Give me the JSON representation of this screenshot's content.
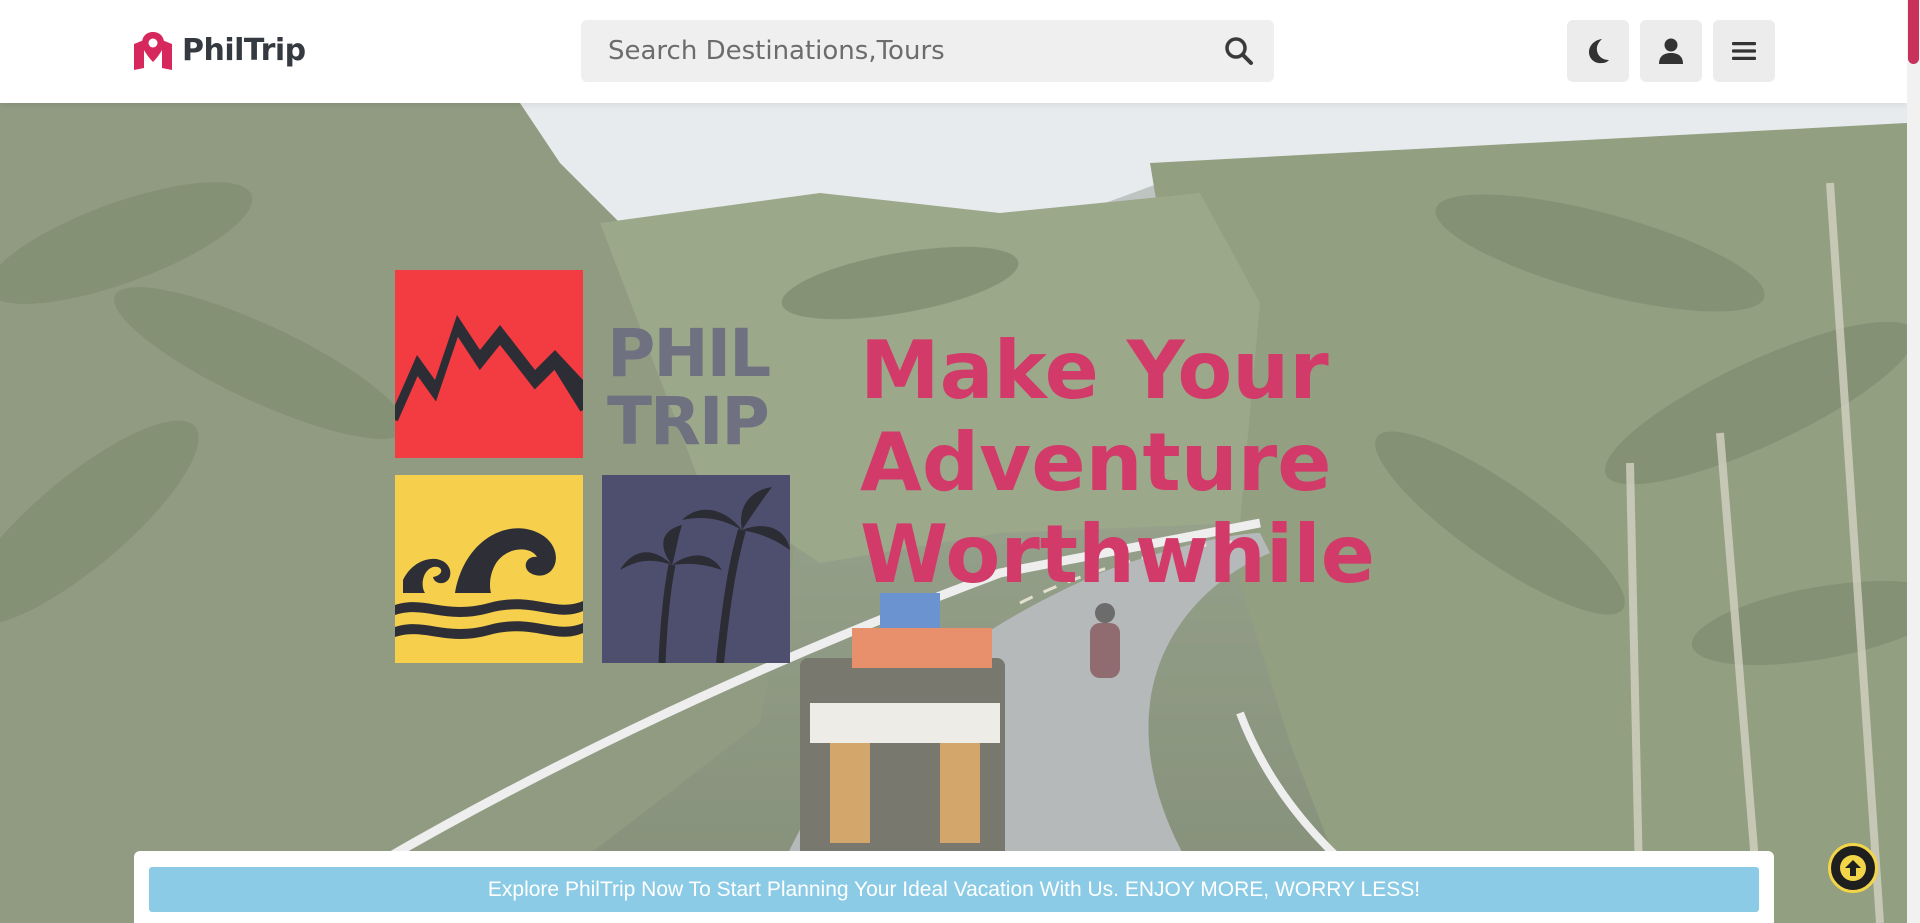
{
  "header": {
    "brand_name": "PhilTrip",
    "search_placeholder": "Search Destinations,Tours",
    "buttons": {
      "dark_mode": "moon-icon",
      "account": "user-icon",
      "menu": "hamburger-icon"
    }
  },
  "hero": {
    "logo_word_line1": "PHIL",
    "logo_word_line2": "TRIP",
    "headline_line1": "Make Your Adventure",
    "headline_line2": "Worthwhile"
  },
  "cta": {
    "text": "Explore PhilTrip Now To Start Planning Your Ideal Vacation With Us. ENJOY MORE, WORRY LESS!"
  },
  "colors": {
    "brand": "#d6285c",
    "headline": "#d23a6a",
    "cta_bar": "#8ccbe6",
    "back_to_top_ring": "#f3d54a"
  }
}
